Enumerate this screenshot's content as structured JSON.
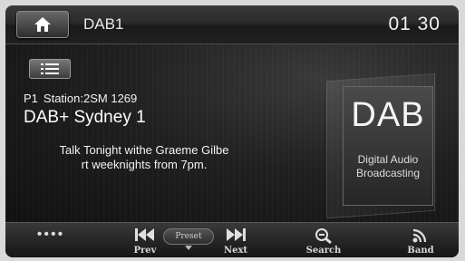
{
  "header": {
    "source": "DAB1",
    "clock": "01 30",
    "home_icon": "home-icon"
  },
  "main": {
    "list_icon": "list-icon",
    "preset": "P1",
    "station_id": "Station:2SM 1269",
    "station_name": "DAB+ Sydney 1",
    "dls_line1": "Talk Tonight withe Graeme Gilbe",
    "dls_line2": "rt weeknights from 7pm.",
    "logo": {
      "text": "DAB",
      "sub_line1": "Digital Audio",
      "sub_line2": "Broadcasting"
    }
  },
  "toolbar": {
    "more_label": "••••",
    "prev_label": "Prev",
    "preset_label": "Preset",
    "next_label": "Next",
    "search_label": "Search",
    "band_label": "Band"
  }
}
